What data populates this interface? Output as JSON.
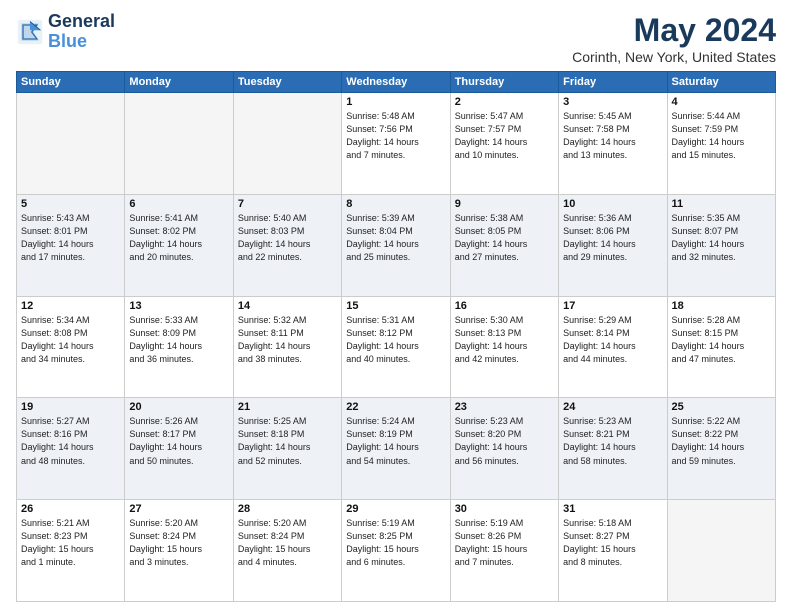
{
  "logo": {
    "line1": "General",
    "line2": "Blue"
  },
  "title": {
    "month_year": "May 2024",
    "location": "Corinth, New York, United States"
  },
  "days_of_week": [
    "Sunday",
    "Monday",
    "Tuesday",
    "Wednesday",
    "Thursday",
    "Friday",
    "Saturday"
  ],
  "weeks": [
    [
      {
        "day": "",
        "info": ""
      },
      {
        "day": "",
        "info": ""
      },
      {
        "day": "",
        "info": ""
      },
      {
        "day": "1",
        "info": "Sunrise: 5:48 AM\nSunset: 7:56 PM\nDaylight: 14 hours\nand 7 minutes."
      },
      {
        "day": "2",
        "info": "Sunrise: 5:47 AM\nSunset: 7:57 PM\nDaylight: 14 hours\nand 10 minutes."
      },
      {
        "day": "3",
        "info": "Sunrise: 5:45 AM\nSunset: 7:58 PM\nDaylight: 14 hours\nand 13 minutes."
      },
      {
        "day": "4",
        "info": "Sunrise: 5:44 AM\nSunset: 7:59 PM\nDaylight: 14 hours\nand 15 minutes."
      }
    ],
    [
      {
        "day": "5",
        "info": "Sunrise: 5:43 AM\nSunset: 8:01 PM\nDaylight: 14 hours\nand 17 minutes."
      },
      {
        "day": "6",
        "info": "Sunrise: 5:41 AM\nSunset: 8:02 PM\nDaylight: 14 hours\nand 20 minutes."
      },
      {
        "day": "7",
        "info": "Sunrise: 5:40 AM\nSunset: 8:03 PM\nDaylight: 14 hours\nand 22 minutes."
      },
      {
        "day": "8",
        "info": "Sunrise: 5:39 AM\nSunset: 8:04 PM\nDaylight: 14 hours\nand 25 minutes."
      },
      {
        "day": "9",
        "info": "Sunrise: 5:38 AM\nSunset: 8:05 PM\nDaylight: 14 hours\nand 27 minutes."
      },
      {
        "day": "10",
        "info": "Sunrise: 5:36 AM\nSunset: 8:06 PM\nDaylight: 14 hours\nand 29 minutes."
      },
      {
        "day": "11",
        "info": "Sunrise: 5:35 AM\nSunset: 8:07 PM\nDaylight: 14 hours\nand 32 minutes."
      }
    ],
    [
      {
        "day": "12",
        "info": "Sunrise: 5:34 AM\nSunset: 8:08 PM\nDaylight: 14 hours\nand 34 minutes."
      },
      {
        "day": "13",
        "info": "Sunrise: 5:33 AM\nSunset: 8:09 PM\nDaylight: 14 hours\nand 36 minutes."
      },
      {
        "day": "14",
        "info": "Sunrise: 5:32 AM\nSunset: 8:11 PM\nDaylight: 14 hours\nand 38 minutes."
      },
      {
        "day": "15",
        "info": "Sunrise: 5:31 AM\nSunset: 8:12 PM\nDaylight: 14 hours\nand 40 minutes."
      },
      {
        "day": "16",
        "info": "Sunrise: 5:30 AM\nSunset: 8:13 PM\nDaylight: 14 hours\nand 42 minutes."
      },
      {
        "day": "17",
        "info": "Sunrise: 5:29 AM\nSunset: 8:14 PM\nDaylight: 14 hours\nand 44 minutes."
      },
      {
        "day": "18",
        "info": "Sunrise: 5:28 AM\nSunset: 8:15 PM\nDaylight: 14 hours\nand 47 minutes."
      }
    ],
    [
      {
        "day": "19",
        "info": "Sunrise: 5:27 AM\nSunset: 8:16 PM\nDaylight: 14 hours\nand 48 minutes."
      },
      {
        "day": "20",
        "info": "Sunrise: 5:26 AM\nSunset: 8:17 PM\nDaylight: 14 hours\nand 50 minutes."
      },
      {
        "day": "21",
        "info": "Sunrise: 5:25 AM\nSunset: 8:18 PM\nDaylight: 14 hours\nand 52 minutes."
      },
      {
        "day": "22",
        "info": "Sunrise: 5:24 AM\nSunset: 8:19 PM\nDaylight: 14 hours\nand 54 minutes."
      },
      {
        "day": "23",
        "info": "Sunrise: 5:23 AM\nSunset: 8:20 PM\nDaylight: 14 hours\nand 56 minutes."
      },
      {
        "day": "24",
        "info": "Sunrise: 5:23 AM\nSunset: 8:21 PM\nDaylight: 14 hours\nand 58 minutes."
      },
      {
        "day": "25",
        "info": "Sunrise: 5:22 AM\nSunset: 8:22 PM\nDaylight: 14 hours\nand 59 minutes."
      }
    ],
    [
      {
        "day": "26",
        "info": "Sunrise: 5:21 AM\nSunset: 8:23 PM\nDaylight: 15 hours\nand 1 minute."
      },
      {
        "day": "27",
        "info": "Sunrise: 5:20 AM\nSunset: 8:24 PM\nDaylight: 15 hours\nand 3 minutes."
      },
      {
        "day": "28",
        "info": "Sunrise: 5:20 AM\nSunset: 8:24 PM\nDaylight: 15 hours\nand 4 minutes."
      },
      {
        "day": "29",
        "info": "Sunrise: 5:19 AM\nSunset: 8:25 PM\nDaylight: 15 hours\nand 6 minutes."
      },
      {
        "day": "30",
        "info": "Sunrise: 5:19 AM\nSunset: 8:26 PM\nDaylight: 15 hours\nand 7 minutes."
      },
      {
        "day": "31",
        "info": "Sunrise: 5:18 AM\nSunset: 8:27 PM\nDaylight: 15 hours\nand 8 minutes."
      },
      {
        "day": "",
        "info": ""
      }
    ]
  ]
}
